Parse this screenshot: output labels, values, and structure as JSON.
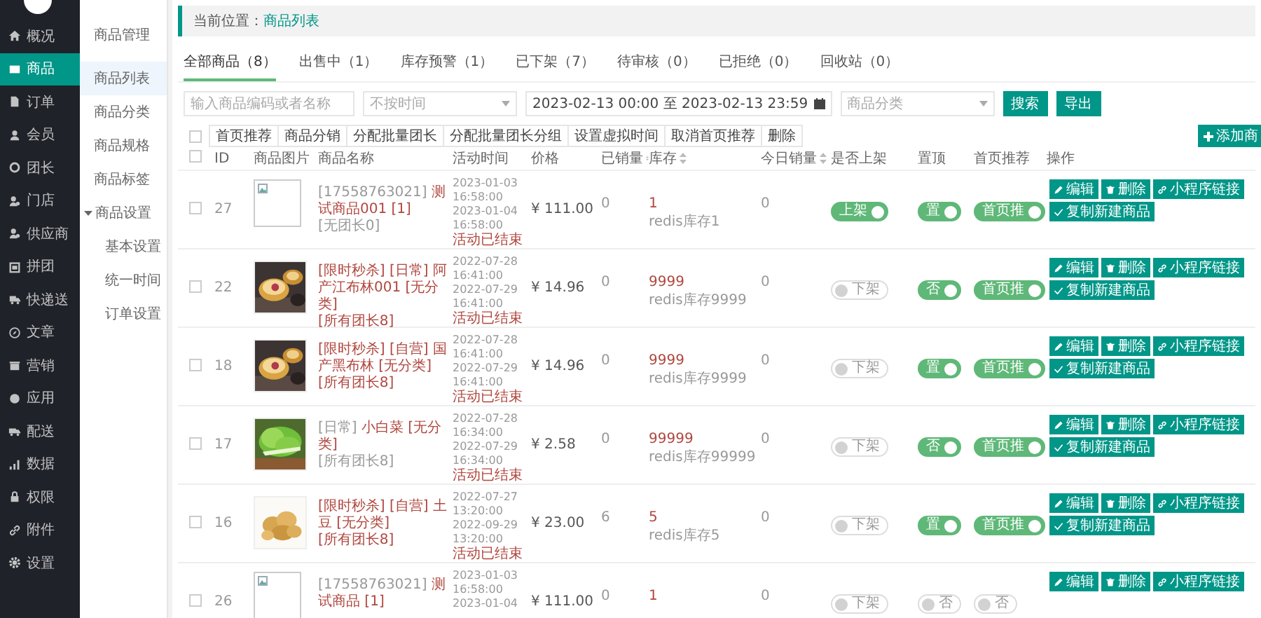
{
  "sidebar": {
    "items": [
      {
        "label": "概况",
        "selected": false
      },
      {
        "label": "商品",
        "selected": true
      },
      {
        "label": "订单",
        "selected": false
      },
      {
        "label": "会员",
        "selected": false
      },
      {
        "label": "团长",
        "selected": false
      },
      {
        "label": "门店",
        "selected": false
      },
      {
        "label": "供应商",
        "selected": false
      },
      {
        "label": "拼团",
        "selected": false
      },
      {
        "label": "快递送",
        "selected": false
      },
      {
        "label": "文章",
        "selected": false
      },
      {
        "label": "营销",
        "selected": false
      },
      {
        "label": "应用",
        "selected": false
      },
      {
        "label": "配送",
        "selected": false
      },
      {
        "label": "数据",
        "selected": false
      },
      {
        "label": "权限",
        "selected": false
      },
      {
        "label": "附件",
        "selected": false
      },
      {
        "label": "设置",
        "selected": false
      }
    ]
  },
  "submenu": {
    "title": "商品管理",
    "items": [
      {
        "label": "商品列表",
        "selected": true
      },
      {
        "label": "商品分类",
        "selected": false
      },
      {
        "label": "商品规格",
        "selected": false
      },
      {
        "label": "商品标签",
        "selected": false
      },
      {
        "label": "商品设置",
        "selected": false,
        "expanded": true,
        "children": [
          {
            "label": "基本设置",
            "selected": false
          },
          {
            "label": "统一时间",
            "selected": false
          },
          {
            "label": "订单设置",
            "selected": false
          }
        ]
      }
    ]
  },
  "breadcrumb": {
    "label": "当前位置：",
    "current": "商品列表"
  },
  "tabs": [
    {
      "label": "全部商品（8）",
      "selected": true
    },
    {
      "label": "出售中（1）",
      "selected": false
    },
    {
      "label": "库存预警（1）",
      "selected": false
    },
    {
      "label": "已下架（7）",
      "selected": false
    },
    {
      "label": "待审核（0）",
      "selected": false
    },
    {
      "label": "已拒绝（0）",
      "selected": false
    },
    {
      "label": "回收站（0）",
      "selected": false
    }
  ],
  "filters": {
    "search": {
      "placeholder": "输入商品编码或者名称"
    },
    "time_select": {
      "placeholder": "不按时间"
    },
    "date_range": {
      "start": "2023-02-13 00:00",
      "separator": "至",
      "end": "2023-02-13 23:59"
    },
    "category_select": {
      "placeholder": "商品分类"
    },
    "buttons": [
      "搜索",
      "导出"
    ]
  },
  "bulk": {
    "select_all": {
      "checked": false
    },
    "actions": [
      "首页推荐",
      "商品分销",
      "分配批量团长",
      "分配批量团长分组",
      "设置虚拟时间",
      "取消首页推荐",
      "删除"
    ]
  },
  "add_button": "添加商",
  "table": {
    "header_checkbox": {
      "checked": false
    },
    "columns": [
      {
        "label": "ID",
        "sortable": false
      },
      {
        "label": "商品图片",
        "sortable": false
      },
      {
        "label": "商品名称",
        "sortable": false
      },
      {
        "label": "活动时间",
        "sortable": false
      },
      {
        "label": "价格",
        "sortable": false
      },
      {
        "label": "已销量",
        "sortable": true
      },
      {
        "label": "库存",
        "sortable": true
      },
      {
        "label": "今日销量",
        "sortable": true
      },
      {
        "label": "是否上架",
        "sortable": false
      },
      {
        "label": "置顶",
        "sortable": false
      },
      {
        "label": "首页推荐",
        "sortable": false
      },
      {
        "label": "操作",
        "sortable": false
      }
    ],
    "rows": [
      {
        "checked": false,
        "id": "27",
        "image": {
          "kind": "broken"
        },
        "prefix": "[17558763021]",
        "title": "测试商品001 [1]",
        "group": {
          "text": "[无团长0]",
          "muted": true
        },
        "time": [
          "2023-01-03",
          "16:58:00",
          "2023-01-04",
          "16:58:00"
        ],
        "status": "活动已结束",
        "price": "¥ 111.00",
        "sold": "0",
        "stock": "1",
        "stock_note": "redis库存1",
        "today": "0",
        "on_sale": {
          "label": "上架",
          "on": true
        },
        "top": {
          "label": "置",
          "on": true
        },
        "home": {
          "label": "首页推",
          "on": true
        },
        "actions": [
          "编辑",
          "删除",
          "小程序链接",
          "复制新建商品"
        ]
      },
      {
        "checked": false,
        "id": "22",
        "image": {
          "kind": "picture"
        },
        "title": "[限时秒杀] [日常] 阿产江布林001 [无分类]",
        "group": {
          "text": "[所有团长8]",
          "muted": false
        },
        "time": [
          "2022-07-28",
          "16:41:00",
          "2022-07-29",
          "16:41:00"
        ],
        "status": "活动已结束",
        "price": "¥ 14.96",
        "sold": "0",
        "stock": "9999",
        "stock_note": "redis库存9999",
        "today": "0",
        "on_sale": {
          "label": "下架",
          "on": false
        },
        "top": {
          "label": "否",
          "on": true
        },
        "home": {
          "label": "首页推",
          "on": true
        },
        "actions": [
          "编辑",
          "删除",
          "小程序链接",
          "复制新建商品"
        ]
      },
      {
        "checked": false,
        "id": "18",
        "image": {
          "kind": "picture"
        },
        "title": "[限时秒杀] [自营] 国产黑布林 [无分类]",
        "group": {
          "text": "[所有团长8]",
          "muted": false
        },
        "time": [
          "2022-07-28",
          "16:41:00",
          "2022-07-29",
          "16:41:00"
        ],
        "status": "活动已结束",
        "price": "¥ 14.96",
        "sold": "0",
        "stock": "9999",
        "stock_note": "redis库存9999",
        "today": "0",
        "on_sale": {
          "label": "下架",
          "on": false
        },
        "top": {
          "label": "置",
          "on": true
        },
        "home": {
          "label": "首页推",
          "on": true
        },
        "actions": [
          "编辑",
          "删除",
          "小程序链接",
          "复制新建商品"
        ]
      },
      {
        "checked": false,
        "id": "17",
        "image": {
          "kind": "picture"
        },
        "prefix": "[日常]",
        "title": "小白菜 [无分类]",
        "group": {
          "text": "[所有团长8]",
          "muted": true
        },
        "time": [
          "2022-07-28",
          "16:34:00",
          "2022-07-29",
          "16:34:00"
        ],
        "status": "活动已结束",
        "price": "¥ 2.58",
        "sold": "0",
        "stock": "99999",
        "stock_note": "redis库存99999",
        "today": "0",
        "on_sale": {
          "label": "下架",
          "on": false
        },
        "top": {
          "label": "否",
          "on": true
        },
        "home": {
          "label": "首页推",
          "on": true
        },
        "actions": [
          "编辑",
          "删除",
          "小程序链接",
          "复制新建商品"
        ]
      },
      {
        "checked": false,
        "id": "16",
        "image": {
          "kind": "picture"
        },
        "title": "[限时秒杀] [自营] 土豆 [无分类]",
        "group": {
          "text": "[所有团长8]",
          "muted": false
        },
        "time": [
          "2022-07-27",
          "13:20:00",
          "2022-09-29",
          "13:20:00"
        ],
        "status": "活动已结束",
        "price": "¥ 23.00",
        "sold": "6",
        "stock": "5",
        "stock_note": "redis库存5",
        "today": "0",
        "on_sale": {
          "label": "下架",
          "on": false
        },
        "top": {
          "label": "置",
          "on": true
        },
        "home": {
          "label": "首页推",
          "on": true
        },
        "actions": [
          "编辑",
          "删除",
          "小程序链接",
          "复制新建商品"
        ]
      },
      {
        "checked": false,
        "id": "26",
        "image": {
          "kind": "broken"
        },
        "prefix": "[17558763021]",
        "title": "测试商品 [1]",
        "time": [
          "2023-01-03",
          "16:58:00",
          "2023-01-04"
        ],
        "price": "¥ 111.00",
        "sold": "0",
        "stock": "1",
        "today": "0",
        "on_sale": {
          "label": "下架",
          "on": false
        },
        "top": {
          "label": "否",
          "on": false
        },
        "home": {
          "label": "否",
          "on": false
        },
        "actions": [
          "编辑",
          "删除",
          "小程序链接"
        ]
      }
    ]
  }
}
